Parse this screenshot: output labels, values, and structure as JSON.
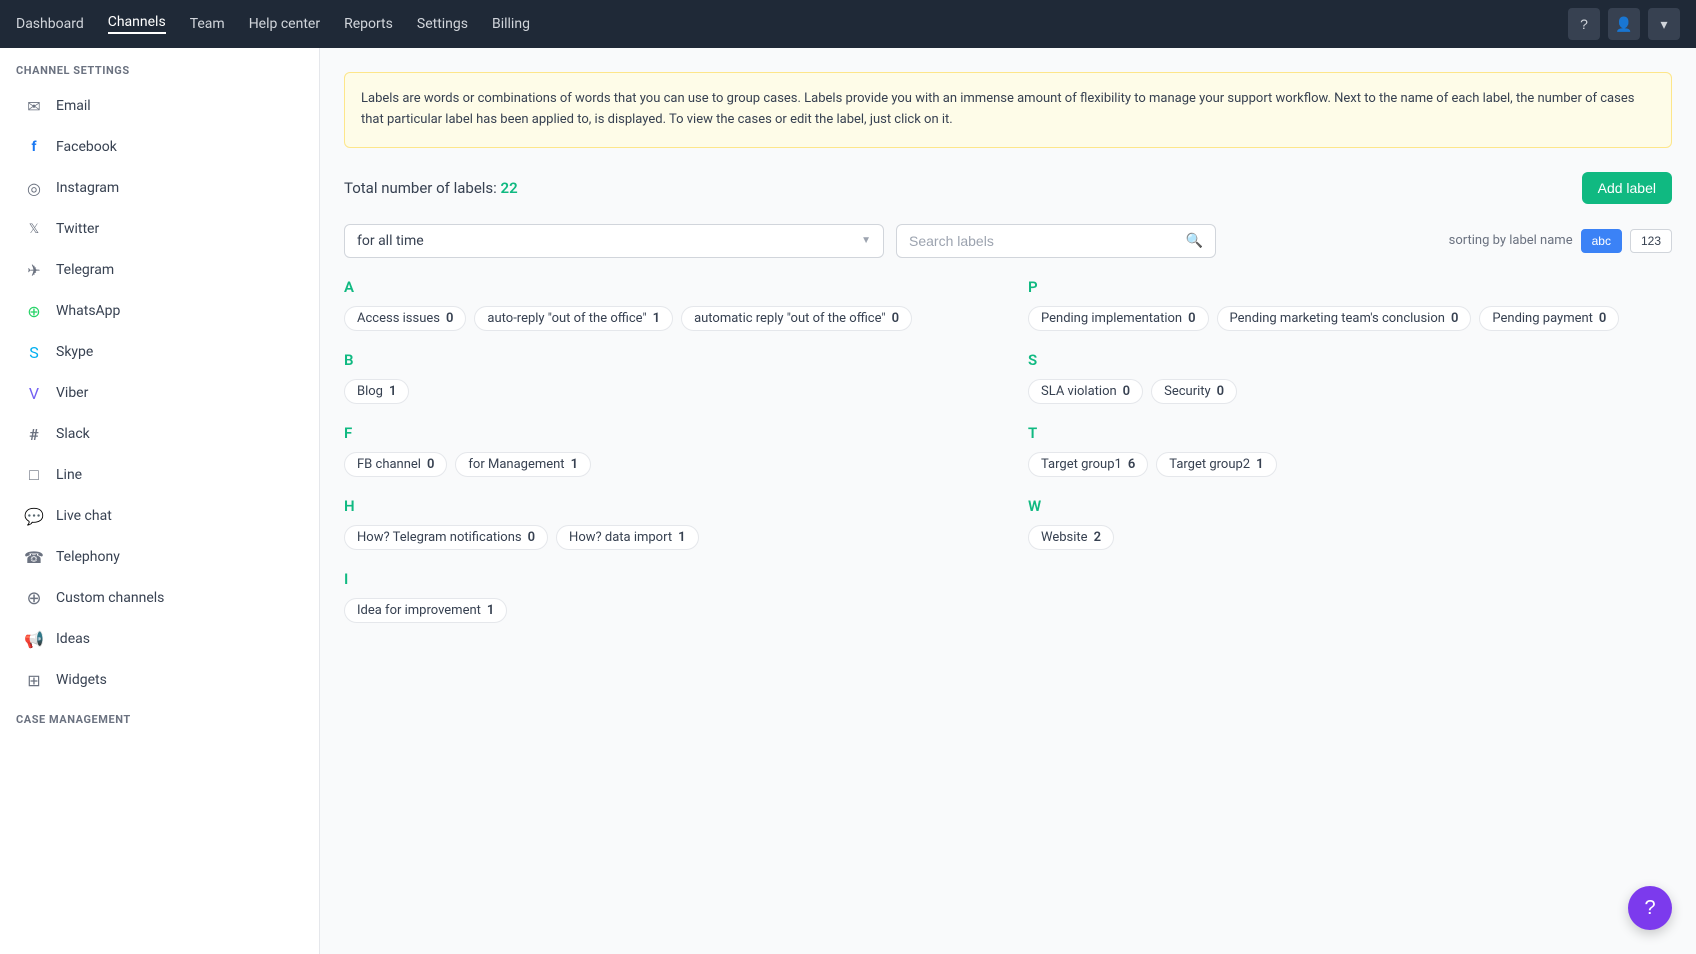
{
  "nav": {
    "brand": "Dashboard",
    "items": [
      {
        "label": "Dashboard",
        "active": false
      },
      {
        "label": "Channels",
        "active": true
      },
      {
        "label": "Team",
        "active": false
      },
      {
        "label": "Help center",
        "active": false
      },
      {
        "label": "Reports",
        "active": false
      },
      {
        "label": "Settings",
        "active": false
      },
      {
        "label": "Billing",
        "active": false
      }
    ],
    "icons": {
      "question": "?",
      "user": "👤",
      "account": "👤"
    }
  },
  "sidebar": {
    "sections": [
      {
        "title": "CHANNEL SETTINGS",
        "items": [
          {
            "label": "Email",
            "icon": "✉"
          },
          {
            "label": "Facebook",
            "icon": "f"
          },
          {
            "label": "Instagram",
            "icon": "◎"
          },
          {
            "label": "Twitter",
            "icon": "𝕏"
          },
          {
            "label": "Telegram",
            "icon": "✈"
          },
          {
            "label": "WhatsApp",
            "icon": "⊕"
          },
          {
            "label": "Skype",
            "icon": "S"
          },
          {
            "label": "Viber",
            "icon": "V"
          },
          {
            "label": "Slack",
            "icon": "#"
          },
          {
            "label": "Line",
            "icon": "□"
          },
          {
            "label": "Live chat",
            "icon": "💬"
          },
          {
            "label": "Telephony",
            "icon": "☎"
          },
          {
            "label": "Custom channels",
            "icon": "+"
          },
          {
            "label": "Ideas",
            "icon": "📢"
          },
          {
            "label": "Widgets",
            "icon": "⊞"
          }
        ]
      }
    ]
  },
  "main": {
    "info_text": "Labels are words or combinations of words that you can use to group cases. Labels provide you with an immense amount of flexibility to manage your support workflow. Next to the name of each label, the number of cases that particular label has been applied to, is displayed. To view the cases or edit the label, just click on it.",
    "total_labels_prefix": "Total number of labels:",
    "total_labels_count": "22",
    "add_label_btn": "Add label",
    "filter": {
      "time_value": "for all time",
      "search_placeholder": "Search labels"
    },
    "sorting": {
      "label": "sorting by label name",
      "btn_abc": "abc",
      "btn_123": "123"
    },
    "label_groups": [
      {
        "letter": "A",
        "col": "left",
        "labels": [
          {
            "name": "Access issues",
            "count": "0"
          },
          {
            "name": "auto-reply \"out of the office\"",
            "count": "1"
          },
          {
            "name": "automatic reply \"out of the office\"",
            "count": "0"
          }
        ]
      },
      {
        "letter": "B",
        "col": "left",
        "labels": [
          {
            "name": "Blog",
            "count": "1"
          }
        ]
      },
      {
        "letter": "F",
        "col": "left",
        "labels": [
          {
            "name": "FB channel",
            "count": "0"
          },
          {
            "name": "for Management",
            "count": "1"
          }
        ]
      },
      {
        "letter": "H",
        "col": "left",
        "labels": [
          {
            "name": "How? Telegram notifications",
            "count": "0"
          },
          {
            "name": "How? data import",
            "count": "1"
          }
        ]
      },
      {
        "letter": "I",
        "col": "left",
        "labels": [
          {
            "name": "Idea for improvement",
            "count": "1"
          }
        ]
      },
      {
        "letter": "P",
        "col": "right",
        "labels": [
          {
            "name": "Pending implementation",
            "count": "0"
          },
          {
            "name": "Pending marketing team's conclusion",
            "count": "0"
          },
          {
            "name": "Pending payment",
            "count": "0"
          }
        ]
      },
      {
        "letter": "S",
        "col": "right",
        "labels": [
          {
            "name": "SLA violation",
            "count": "0"
          },
          {
            "name": "Security",
            "count": "0"
          }
        ]
      },
      {
        "letter": "T",
        "col": "right",
        "labels": [
          {
            "name": "Target group1",
            "count": "6"
          },
          {
            "name": "Target group2",
            "count": "1"
          }
        ]
      },
      {
        "letter": "W",
        "col": "right",
        "labels": [
          {
            "name": "Website",
            "count": "2"
          }
        ]
      }
    ]
  }
}
